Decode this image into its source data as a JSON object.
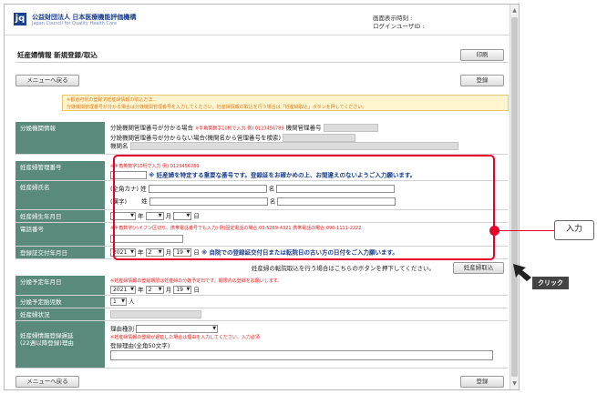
{
  "header": {
    "logo_text": "jq",
    "org_name_ja": "公益財団法人 日本医療機能評価機構",
    "org_name_en": "Japan Council for Quality Health Care",
    "display_time_label": "画面表示時刻 :",
    "login_user_label": "ログインユーザID :"
  },
  "page": {
    "title": "妊産婦情報 新規登録/取込",
    "print_button": "印刷",
    "back_to_menu": "メニューへ戻る",
    "register_button": "登録"
  },
  "notice": {
    "line1": "※都道府県の登録済妊産婦情報の取込方法...",
    "line2": "分娩機関管理番号が分かる場合は分娩機関管理番号を入力してください。妊産婦情報の取込を行う場合は「妊産婦取込」ボタンを押してください。"
  },
  "form": {
    "facility": {
      "label": "分娩機関情報",
      "line1": "分娩機関管理番号が分かる場合",
      "line1_note": "※半角英数字10桁で入力 例) 0123456789",
      "line1_right": "機関管理番号",
      "line2": "分娩機関管理番号が分からない場合(機関名から管理番号を検索)",
      "line3": "機関名"
    },
    "mgmt_no": {
      "label": "妊産婦管理番号",
      "note": "※半角英数字10桁で入力 例) 0123456789",
      "hint": "※ 妊産婦を特定する重要な番号です。登録証をお確かめの上、お間違えのないようご入力願います。"
    },
    "name": {
      "label": "妊産婦氏名",
      "kana_label": "(全角カナ) 姓",
      "kanji_label": "(漢字)",
      "sei": "姓",
      "mei": "名"
    },
    "birth": {
      "label": "妊産婦生年月日",
      "year_unit": "年",
      "month_unit": "月",
      "day_unit": "日"
    },
    "phone": {
      "label": "電話番号",
      "note": "※半角数字(ハイフン区切り、携帯電話番号でも入力) 例)固定電話の場合:03-5269-4321 携帯電話の場合:090-1111-2222"
    },
    "issue_date": {
      "label": "登録証交付年月日",
      "year": "2021",
      "year_unit": "年",
      "month": "2",
      "month_unit": "月",
      "day": "19",
      "day_unit": "日",
      "hint": "※ 自院での登録証交付日または転院日の古い方の日付をご入力願います。"
    },
    "import_row": {
      "text": "妊産婦の転院取込を行う場合はこちらのボタンを押下してください。",
      "button": "妊産婦取込"
    },
    "due_date": {
      "label": "分娩予定年月日",
      "note": "※妊産婦情報の登録期限は妊産婦の分娩予定日です。期限内の登録をお願いします。",
      "year": "2021",
      "year_unit": "年",
      "month": "2",
      "month_unit": "月",
      "day": "19",
      "day_unit": "日"
    },
    "fetus": {
      "label": "分娩予定胎児数",
      "value": "1",
      "unit": "人"
    },
    "status": {
      "label": "妊産婦状況"
    },
    "delay": {
      "label": "妊産婦情報登録遅延\n(22週以降登録)理由",
      "type_label": "理由種別",
      "note": "※妊産婦情報の登録が遅延した場合は理由を入力してください。入力必須",
      "reason_label": "登録理由(全角50文字)"
    }
  },
  "annotations": {
    "input_label": "入力",
    "click_label": "クリック"
  },
  "colors": {
    "label_bg": "#5a8a7c",
    "highlight": "#e8002a",
    "brand": "#1a3f8c"
  }
}
